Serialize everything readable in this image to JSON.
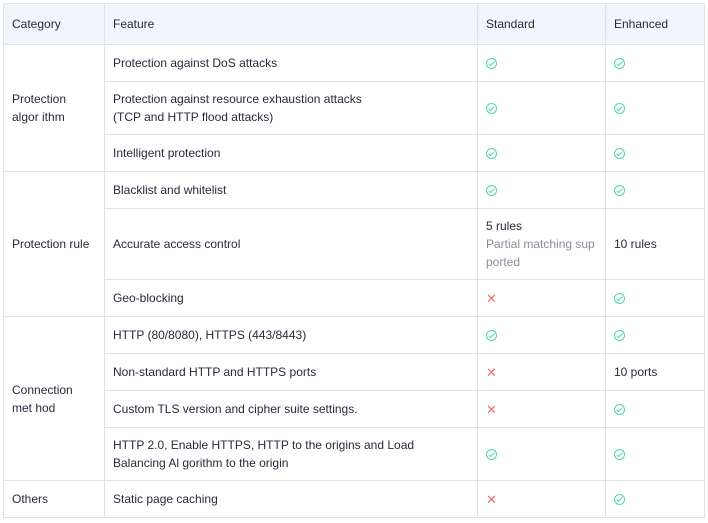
{
  "headers": [
    "Category",
    "Feature",
    "Standard",
    "Enhanced"
  ],
  "categories": {
    "algorithm": "Protection algor ithm",
    "rule": "Protection rule",
    "connection": "Connection met hod",
    "others": "Others"
  },
  "features": {
    "dos": "Protection against DoS attacks",
    "exhaustion_l1": "Protection against resource exhaustion attacks",
    "exhaustion_l2": "(TCP and HTTP flood attacks)",
    "intelligent": "Intelligent protection",
    "blacklist": "Blacklist and whitelist",
    "access_control": "Accurate access control",
    "geo": "Geo-blocking",
    "ports_std": "HTTP (80/8080), HTTPS (443/8443)",
    "ports_nonstd": "Non-standard HTTP and HTTPS ports",
    "tls": "Custom TLS version and cipher suite settings.",
    "http2": "HTTP 2.0, Enable HTTPS, HTTP to the origins and Load Balancing Al gorithm to the origin",
    "caching": "Static page caching"
  },
  "values": {
    "access_control_standard": "5 rules",
    "access_control_standard_note": "Partial matching sup ported",
    "access_control_enhanced": "10 rules",
    "ports_nonstd_enhanced": "10 ports"
  },
  "icons": {
    "supported": "check-circle-icon",
    "unsupported": "cross-icon"
  },
  "colors": {
    "supported": "#50d4ab",
    "unsupported": "#f66f6a",
    "header_bg": "#f2f5fc",
    "border": "#dfe1e6"
  }
}
